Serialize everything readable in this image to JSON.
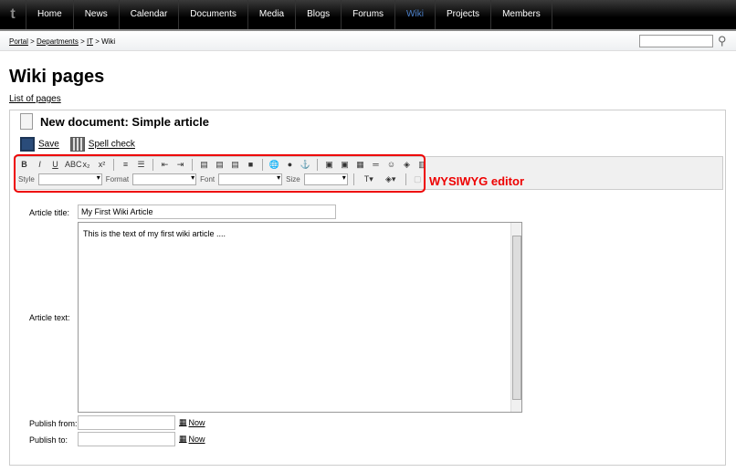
{
  "nav": {
    "items": [
      "Home",
      "News",
      "Calendar",
      "Documents",
      "Media",
      "Blogs",
      "Forums",
      "Wiki",
      "Projects",
      "Members"
    ],
    "active": "Wiki"
  },
  "breadcrumb": {
    "items": [
      "Portal",
      "Departments",
      "IT",
      "Wiki"
    ],
    "separator": ">"
  },
  "search": {
    "value": ""
  },
  "page": {
    "title": "Wiki pages",
    "list_link": "List of pages"
  },
  "document": {
    "title": "New document: Simple article",
    "save": "Save",
    "spellcheck": "Spell check"
  },
  "toolbar": {
    "row1": [
      "B",
      "I",
      "U",
      "ABC",
      "x₂",
      "x²",
      "|",
      "≡",
      "☰",
      "|",
      "⇤",
      "⇥",
      "|",
      "▤",
      "▤",
      "▤",
      "■",
      "|",
      "🌐",
      "●",
      "⚓",
      "|",
      "▣",
      "▣",
      "▦",
      "═",
      "☺",
      "◈",
      "▥"
    ],
    "style_label": "Style",
    "format_label": "Format",
    "font_label": "Font",
    "size_label": "Size",
    "annotation": "WYSIWYG editor",
    "annotation_color": "#e00000"
  },
  "form": {
    "article_title_label": "Article title:",
    "article_title_value": "My First Wiki Article",
    "article_text_label": "Article text:",
    "article_text_value": "This is the text of my first wiki article ....",
    "publish_from_label": "Publish from:",
    "publish_to_label": "Publish to:",
    "now_label": "Now"
  }
}
